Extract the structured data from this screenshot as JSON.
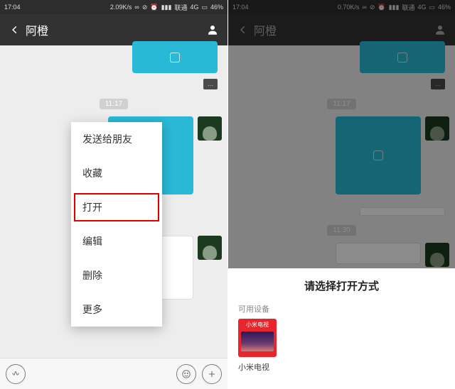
{
  "left": {
    "status": {
      "time": "17:04",
      "speed": "2.09K/s",
      "carrier": "联通",
      "net": "4G",
      "battery": "46%"
    },
    "header": {
      "title": "阿橙"
    },
    "timestamp": "11:17",
    "dark_caption": "…",
    "menu": {
      "items": [
        {
          "label": "发送给朋友",
          "highlight": false
        },
        {
          "label": "收藏",
          "highlight": false
        },
        {
          "label": "打开",
          "highlight": true
        },
        {
          "label": "编辑",
          "highlight": false
        },
        {
          "label": "删除",
          "highlight": false
        },
        {
          "label": "更多",
          "highlight": false
        }
      ]
    }
  },
  "right": {
    "status": {
      "time": "17:04",
      "speed": "0.70K/s",
      "carrier": "联通",
      "net": "4G",
      "battery": "46%"
    },
    "header": {
      "title": "阿橙"
    },
    "timestamp1": "11:17",
    "timestamp2": "11:30",
    "sheet": {
      "title": "请选择打开方式",
      "section": "可用设备",
      "device_tile_label": "小米电视",
      "device_name": "小米电视"
    }
  }
}
